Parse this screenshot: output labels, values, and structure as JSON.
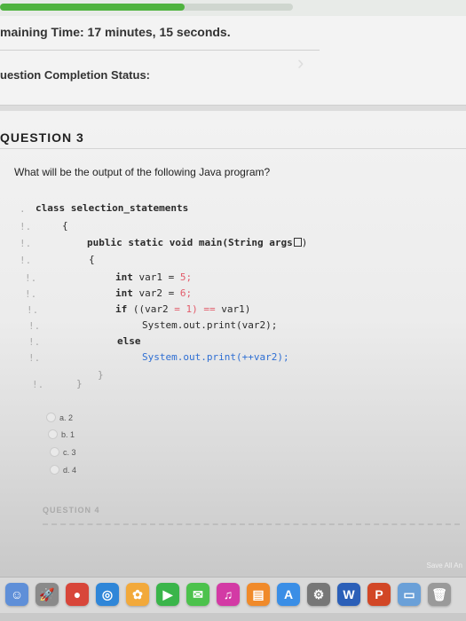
{
  "progress": {
    "percent": 63
  },
  "header": {
    "remaining_time": "maining Time: 17 minutes, 15 seconds.",
    "completion_status": "uestion Completion Status:"
  },
  "question": {
    "title": "QUESTION 3",
    "text": "What will be the output of the following Java program?",
    "code": {
      "line1": "class selection_statements",
      "line2": "{",
      "line3": "public static void main(String args",
      "line3_end": ")",
      "line4": "{",
      "line5_kw": "int",
      "line5_rest": " var1 = ",
      "line5_num": "5",
      "line6_kw": "int",
      "line6_rest": " var2 = ",
      "line6_num": "6",
      "line7_kw": "if",
      "line7_a": " ((var2 ",
      "line7_b": "= ",
      "line7_c": "1) ",
      "line7_d": "== ",
      "line7_e": "var1)",
      "line8": "System.out.print(var2);",
      "line9": "else",
      "line10": "System.out.print(++var2);",
      "line11": "}",
      "line12": "}"
    },
    "answers": [
      {
        "label": "a. 2"
      },
      {
        "label": "b. 1"
      },
      {
        "label": "c. 3"
      },
      {
        "label": "d. 4"
      }
    ]
  },
  "next_question": {
    "title": "QUESTION 4"
  },
  "footer": {
    "save_all": "Save All An"
  },
  "dock": {
    "icons": [
      {
        "name": "finder-icon",
        "color": "#5f8fd8",
        "glyph": "☺"
      },
      {
        "name": "launchpad-icon",
        "color": "#8a8a8a",
        "glyph": "🚀"
      },
      {
        "name": "chrome-icon",
        "color": "#d8463a",
        "glyph": "●"
      },
      {
        "name": "safari-icon",
        "color": "#2f86d8",
        "glyph": "◎"
      },
      {
        "name": "photos-icon",
        "color": "#f2a93b",
        "glyph": "✿"
      },
      {
        "name": "facetime-icon",
        "color": "#3ab54a",
        "glyph": "▶"
      },
      {
        "name": "messages-icon",
        "color": "#4cc24c",
        "glyph": "✉"
      },
      {
        "name": "itunes-icon",
        "color": "#d33aa5",
        "glyph": "♫"
      },
      {
        "name": "ibooks-icon",
        "color": "#f08a2a",
        "glyph": "▤"
      },
      {
        "name": "appstore-icon",
        "color": "#3a8ee6",
        "glyph": "A"
      },
      {
        "name": "settings-icon",
        "color": "#777",
        "glyph": "⚙"
      },
      {
        "name": "word-icon",
        "color": "#2b5fb8",
        "glyph": "W"
      },
      {
        "name": "powerpoint-icon",
        "color": "#d24726",
        "glyph": "P"
      },
      {
        "name": "folder-icon",
        "color": "#6aa0d8",
        "glyph": "▭"
      },
      {
        "name": "trash-icon",
        "color": "#9a9a9a",
        "glyph": "🗑"
      }
    ]
  }
}
